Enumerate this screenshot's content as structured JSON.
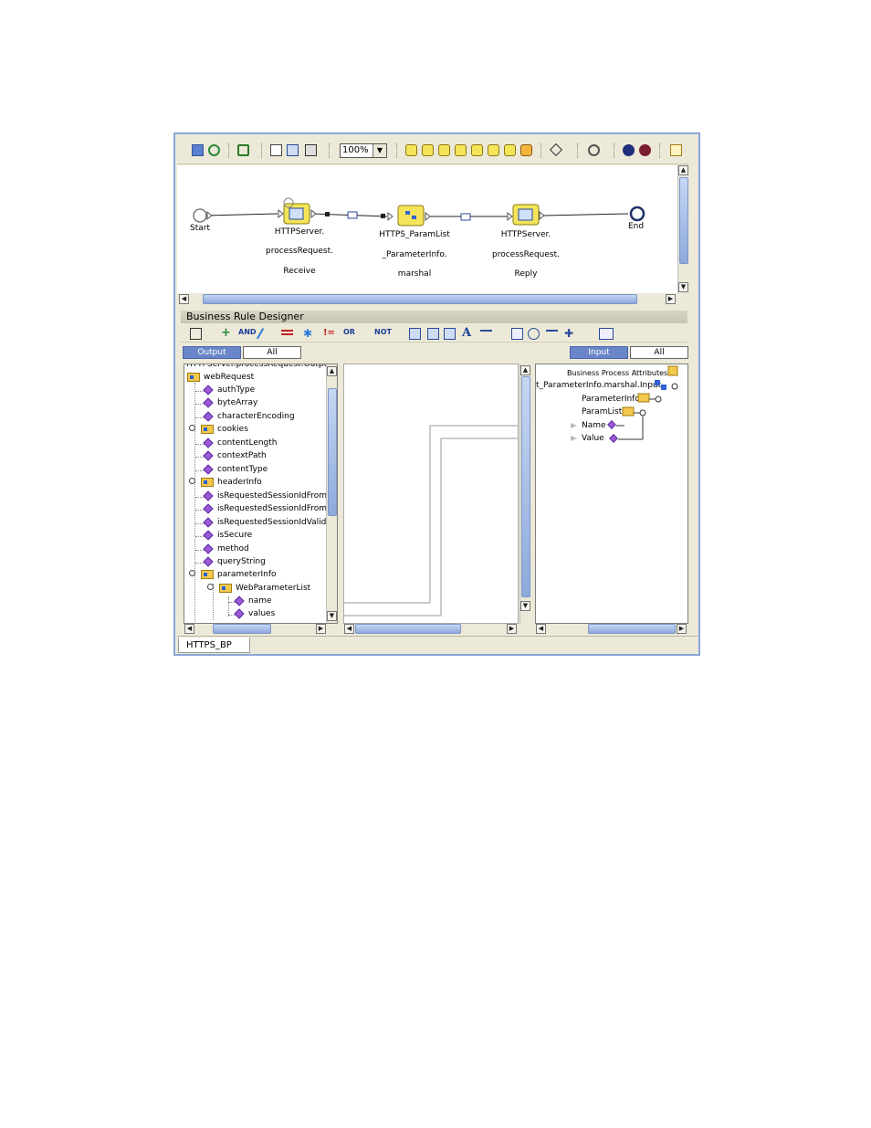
{
  "toolbar": {
    "zoom_value": "100%"
  },
  "process": {
    "start_label": "Start",
    "end_label": "End",
    "node1_line1": "HTTPServer.",
    "node1_line2": "processRequest.",
    "node1_line3": "Receive",
    "node2_line1": "HTTPS_ParamList",
    "node2_line2": "_ParameterInfo.",
    "node2_line3": "marshal",
    "node3_line1": "HTTPServer.",
    "node3_line2": "processRequest.",
    "node3_line3": "Reply"
  },
  "brd": {
    "title": "Business Rule Designer",
    "toolbar_items": [
      "AND",
      "OR",
      "NOT",
      "A"
    ],
    "output_tab": "Output",
    "output_all_tab": "All",
    "input_tab": "Input",
    "input_all_tab": "All"
  },
  "output_tree": {
    "header": "HTTPServer.processRequest.Output",
    "root": "webRequest",
    "items": [
      "authType",
      "byteArray",
      "characterEncoding",
      "cookies",
      "contentLength",
      "contextPath",
      "contentType",
      "headerInfo",
      "isRequestedSessionIdFromC",
      "isRequestedSessionIdFromU",
      "isRequestedSessionIdValid",
      "isSecure",
      "method",
      "queryString",
      "parameterInfo",
      "WebParameterList",
      "name",
      "values"
    ]
  },
  "input_tree": {
    "header": "Business Process Attributes",
    "root": "t_ParameterInfo.marshal.Input",
    "parameter_info": "ParameterInfo",
    "param_list": "ParamList",
    "name": "Name",
    "value": "Value"
  },
  "status": {
    "tab_label": "HTTPS_BP"
  }
}
